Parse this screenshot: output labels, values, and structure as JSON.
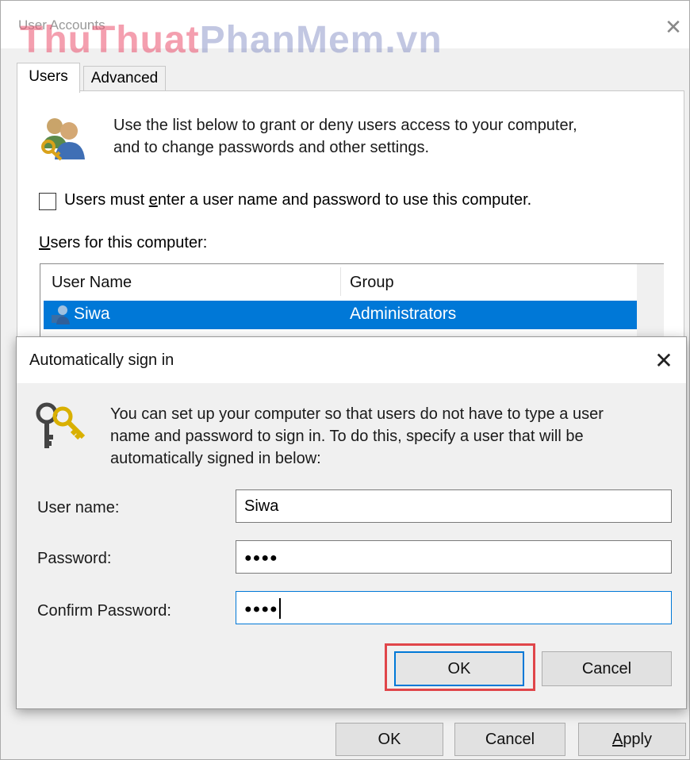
{
  "outer": {
    "title": "User Accounts",
    "watermark_part1": "ThuThuat",
    "watermark_part2": "PhanMem.vn",
    "close_glyph": "✕",
    "tabs": [
      "Users",
      "Advanced"
    ],
    "intro_line1": "Use the list below to grant or deny users access to your computer,",
    "intro_line2": "and to change passwords and other settings.",
    "checkbox_label_pre": "Users must ",
    "checkbox_label_accel": "e",
    "checkbox_label_post": "nter a user name and password to use this computer.",
    "checkbox_checked": false,
    "users_label_accel": "U",
    "users_label_rest": "sers for this computer:",
    "table": {
      "columns": [
        "User Name",
        "Group"
      ],
      "rows": [
        {
          "name": "Siwa",
          "group": "Administrators",
          "selected": true
        }
      ]
    },
    "buttons": {
      "ok": "OK",
      "cancel": "Cancel",
      "apply_accel": "A",
      "apply_rest": "pply"
    }
  },
  "dialog": {
    "title": "Automatically sign in",
    "close_glyph": "✕",
    "desc_line1": "You can set up your computer so that users do not have to type a user",
    "desc_line2": "name and password to sign in. To do this, specify a user that will be",
    "desc_line3": "automatically signed in below:",
    "fields": {
      "user_name_label": "User name:",
      "user_name_value": "Siwa",
      "password_label": "Password:",
      "password_value": "●●●●",
      "confirm_label": "Confirm Password:",
      "confirm_value": "●●●●"
    },
    "buttons": {
      "ok": "OK",
      "cancel": "Cancel"
    }
  },
  "colors": {
    "selection": "#0078d7",
    "highlight_box": "#e0464a",
    "watermark": "#eb506e"
  },
  "icons": {
    "users": "users-key-icon",
    "key": "keys-icon",
    "row": "user-avatar-icon"
  }
}
